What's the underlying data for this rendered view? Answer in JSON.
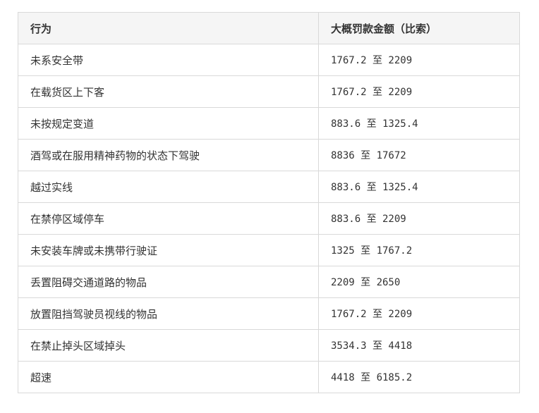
{
  "table": {
    "headers": [
      "行为",
      "大概罚款金额（比索）"
    ],
    "rows": [
      [
        "未系安全带",
        "1767.2 至 2209"
      ],
      [
        "在载货区上下客",
        "1767.2 至 2209"
      ],
      [
        "未按规定变道",
        "883.6 至 1325.4"
      ],
      [
        "酒驾或在服用精神药物的状态下驾驶",
        "8836 至 17672"
      ],
      [
        "越过实线",
        "883.6 至 1325.4"
      ],
      [
        "在禁停区域停车",
        "883.6 至 2209"
      ],
      [
        "未安装车牌或未携带行驶证",
        "1325 至 1767.2"
      ],
      [
        "丢置阻碍交通道路的物品",
        "2209 至 2650"
      ],
      [
        "放置阻挡驾驶员视线的物品",
        "1767.2 至 2209"
      ],
      [
        "在禁止掉头区域掉头",
        "3534.3 至 4418"
      ],
      [
        "超速",
        "4418 至 6185.2"
      ]
    ]
  }
}
